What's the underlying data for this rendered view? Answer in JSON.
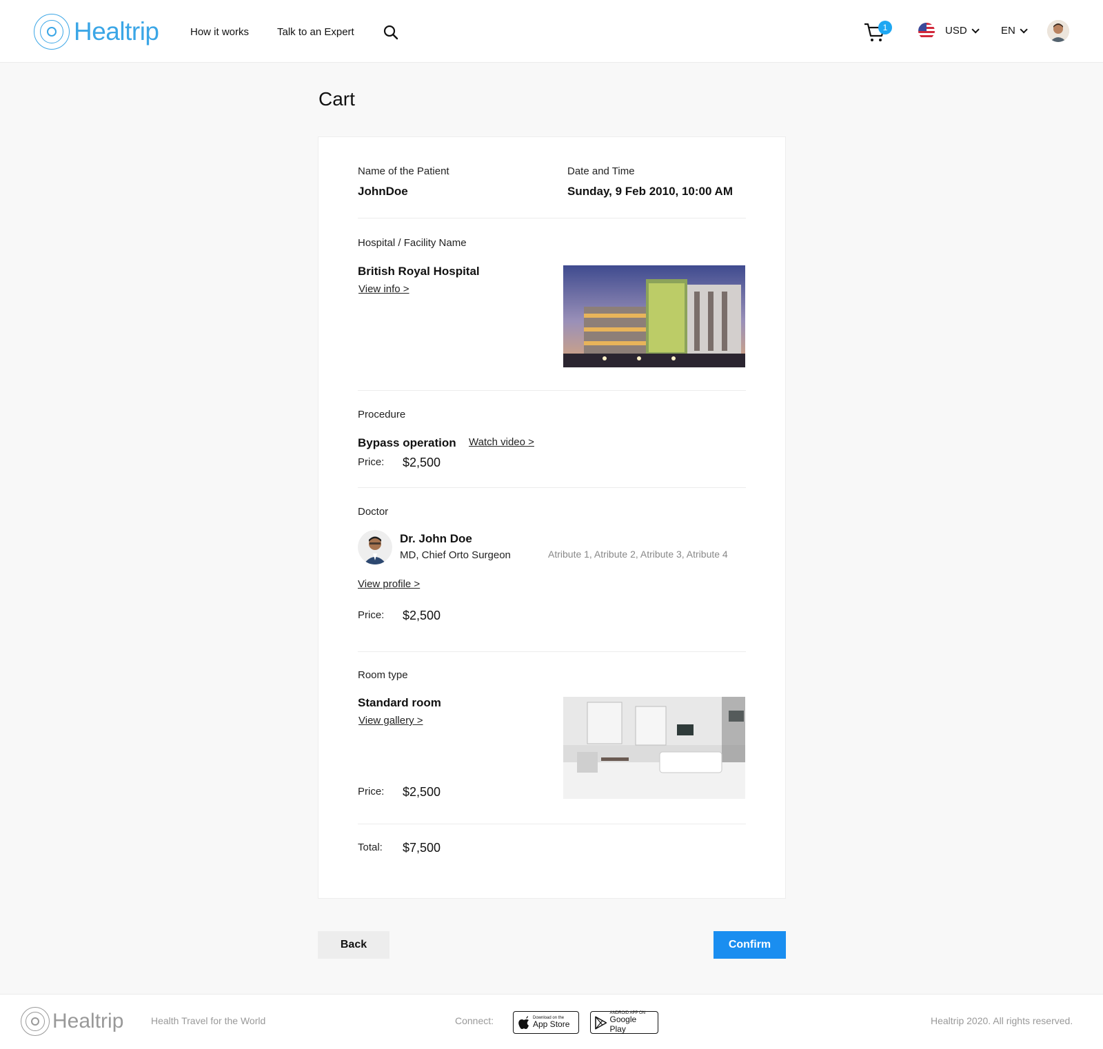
{
  "header": {
    "logo_text": "Healtrip",
    "nav": [
      "How it works",
      "Talk to an Expert"
    ],
    "cart_count": "1",
    "currency": "USD",
    "language": "EN"
  },
  "page": {
    "title": "Cart"
  },
  "patient": {
    "name_label": "Name of the Patient",
    "name_value": "JohnDoe",
    "date_label": "Date and Time",
    "date_value": "Sunday, 9 Feb 2010, 10:00 AM"
  },
  "hospital": {
    "label": "Hospital / Facility Name",
    "name": "British Royal Hospital",
    "link": "View info >"
  },
  "procedure": {
    "label": "Procedure",
    "name": "Bypass operation",
    "link": "Watch video >",
    "price_label": "Price:",
    "price": "$2,500"
  },
  "doctor": {
    "label": "Doctor",
    "name": "Dr. John Doe",
    "title": "MD, Chief Orto Surgeon",
    "attributes": "Atribute 1, Atribute 2, Atribute 3, Atribute 4",
    "link": "View profile >",
    "price_label": "Price:",
    "price": "$2,500"
  },
  "room": {
    "label": "Room type",
    "name": "Standard room",
    "link": "View gallery >",
    "price_label": "Price:",
    "price": "$2,500"
  },
  "total": {
    "label": "Total:",
    "value": "$7,500"
  },
  "actions": {
    "back": "Back",
    "confirm": "Confirm"
  },
  "footer": {
    "logo_text": "Healtrip",
    "tagline": "Health Travel for the World",
    "connect": "Connect:",
    "appstore_small": "Download on the",
    "appstore_big": "App Store",
    "googleplay_small": "ANDROID APP ON",
    "googleplay_big": "Google Play",
    "copyright": "Healtrip 2020. All rights reserved."
  },
  "colors": {
    "brand": "#3ba6e6",
    "confirm": "#1a8ef0",
    "badge": "#1ea7f2"
  }
}
